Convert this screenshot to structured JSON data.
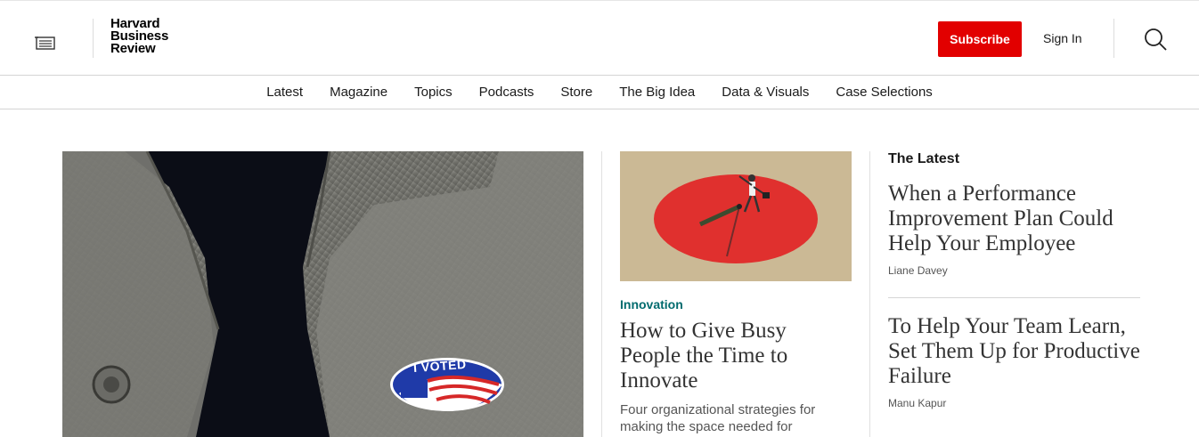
{
  "header": {
    "logo_lines": [
      "Harvard",
      "Business",
      "Review"
    ],
    "subscribe_label": "Subscribe",
    "signin_label": "Sign In",
    "menu_icon": "menu-icon",
    "search_icon": "search-icon"
  },
  "nav": {
    "items": [
      "Latest",
      "Magazine",
      "Topics",
      "Podcasts",
      "Store",
      "The Big Idea",
      "Data & Visuals",
      "Case Selections"
    ]
  },
  "hero": {
    "badge_text": "I VOTED"
  },
  "feature": {
    "category": "Innovation",
    "title": "How to Give Busy People the Time to Innovate",
    "dek": "Four organizational strategies for making the space needed for"
  },
  "latest": {
    "heading": "The Latest",
    "items": [
      {
        "title": "When a Performance Improvement Plan Could Help Your Employee",
        "author": "Liane Davey"
      },
      {
        "title": "To Help Your Team Learn, Set Them Up for Productive Failure",
        "author": "Manu Kapur"
      }
    ]
  },
  "colors": {
    "accent_red": "#e20000",
    "category_teal": "#006b6e"
  }
}
